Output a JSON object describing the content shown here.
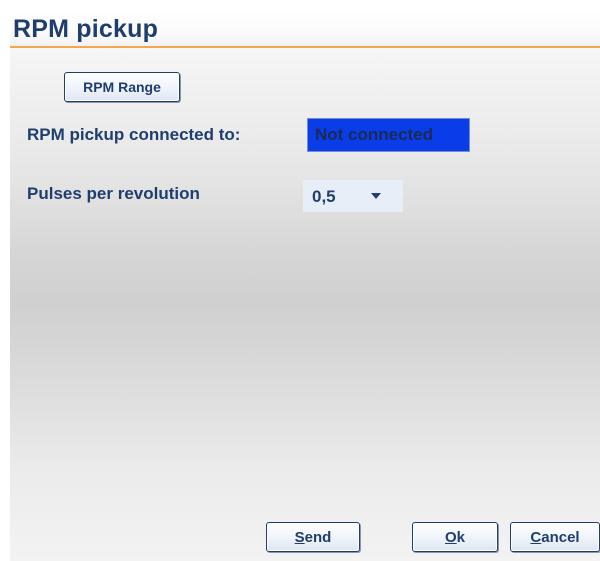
{
  "window": {
    "title": "RPM pickup"
  },
  "buttons": {
    "rpm_range": "RPM Range",
    "send_mnemonic": "S",
    "send_rest": "end",
    "ok_mnemonic": "O",
    "ok_rest": "k",
    "cancel_mnemonic": "C",
    "cancel_rest": "ancel"
  },
  "fields": {
    "connected_label": "RPM pickup connected to:",
    "connected_value": "Not connected",
    "pulses_label": "Pulses per revolution",
    "pulses_value": "0,5"
  },
  "icons": {
    "dropdown": "chevron-down-icon"
  },
  "colors": {
    "accent_text": "#1f3e6e",
    "title_underline": "#f2a64f",
    "selected_field_bg": "#0a3de8"
  }
}
